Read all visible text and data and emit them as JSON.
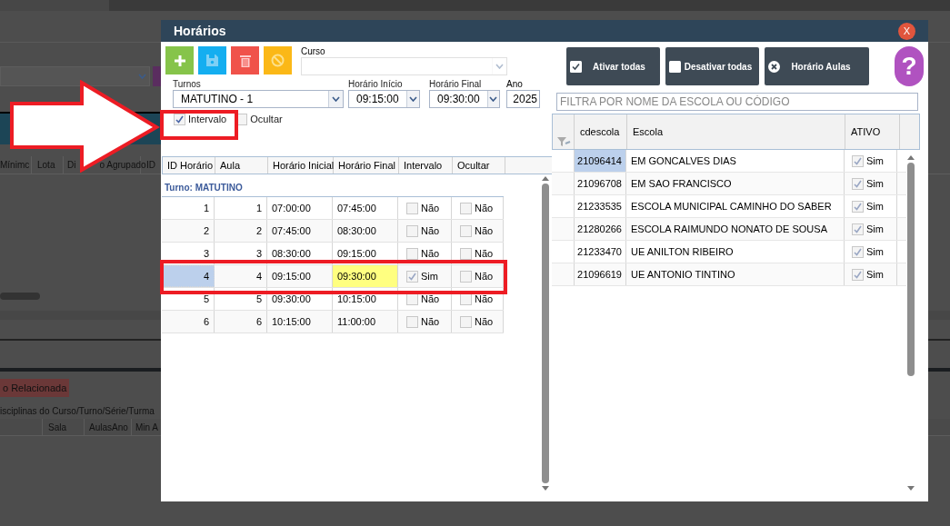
{
  "background": {
    "columns": [
      "Mínimc",
      "Lota",
      "Di",
      "o Agrupado",
      "ID"
    ],
    "related_button": "o Relacionada",
    "section_title": "isciplinas do Curso/Turno/Série/Turma",
    "sub_columns": [
      "Sala",
      "AulasAno",
      "Min A"
    ]
  },
  "dialog": {
    "title": "Horários",
    "close": "X",
    "course": {
      "label": "Curso"
    },
    "shift": {
      "label": "Turnos",
      "value": "MATUTINO - 1"
    },
    "start": {
      "label": "Horário Início",
      "value": "09:15:00"
    },
    "end": {
      "label": "Horário Final",
      "value": "09:30:00"
    },
    "year": {
      "label": "Ano",
      "value": "2025"
    },
    "options": [
      {
        "label": "Intervalo",
        "checked": true
      },
      {
        "label": "Ocultar",
        "checked": false
      }
    ],
    "schedule": {
      "columns": [
        "ID Horário",
        "Aula",
        "Horário Inicial",
        "Horário Final",
        "Intervalo",
        "Ocultar"
      ],
      "group": "Turno: MATUTINO",
      "rows": [
        {
          "id": "1",
          "aula": "1",
          "inicio": "07:00:00",
          "final": "07:45:00",
          "intervalo": {
            "checked": false,
            "label": "Não"
          },
          "ocultar": {
            "checked": false,
            "label": "Não"
          },
          "selected": false,
          "edited": false
        },
        {
          "id": "2",
          "aula": "2",
          "inicio": "07:45:00",
          "final": "08:30:00",
          "intervalo": {
            "checked": false,
            "label": "Não"
          },
          "ocultar": {
            "checked": false,
            "label": "Não"
          },
          "selected": false,
          "edited": false
        },
        {
          "id": "3",
          "aula": "3",
          "inicio": "08:30:00",
          "final": "09:15:00",
          "intervalo": {
            "checked": false,
            "label": "Não"
          },
          "ocultar": {
            "checked": false,
            "label": "Não"
          },
          "selected": false,
          "edited": false
        },
        {
          "id": "4",
          "aula": "4",
          "inicio": "09:15:00",
          "final": "09:30:00",
          "intervalo": {
            "checked": true,
            "label": "Sim"
          },
          "ocultar": {
            "checked": false,
            "label": "Não"
          },
          "selected": true,
          "edited": true
        },
        {
          "id": "5",
          "aula": "5",
          "inicio": "09:30:00",
          "final": "10:15:00",
          "intervalo": {
            "checked": false,
            "label": "Não"
          },
          "ocultar": {
            "checked": false,
            "label": "Não"
          },
          "selected": false,
          "edited": false
        },
        {
          "id": "6",
          "aula": "6",
          "inicio": "10:15:00",
          "final": "11:00:00",
          "intervalo": {
            "checked": false,
            "label": "Não"
          },
          "ocultar": {
            "checked": false,
            "label": "Não"
          },
          "selected": false,
          "edited": false
        }
      ]
    },
    "actions": [
      {
        "kind": "check",
        "label": "Ativar todas"
      },
      {
        "kind": "uncheck",
        "label": "Desativar todas"
      },
      {
        "kind": "close",
        "label": "Horário Aulas"
      }
    ],
    "help": "?",
    "filter": {
      "placeholder": "FILTRA POR NOME DA ESCOLA OU CÓDIGO"
    },
    "schools": {
      "columns": [
        "cdescola",
        "Escola",
        "ATIVO"
      ],
      "rows": [
        {
          "code": "21096414",
          "name": "EM GONCALVES DIAS",
          "active": true,
          "label": "Sim",
          "selected": true
        },
        {
          "code": "21096708",
          "name": "EM SAO FRANCISCO",
          "active": true,
          "label": "Sim",
          "selected": false
        },
        {
          "code": "21233535",
          "name": "ESCOLA MUNICIPAL CAMINHO DO SABER",
          "active": true,
          "label": "Sim",
          "selected": false
        },
        {
          "code": "21280266",
          "name": "ESCOLA RAIMUNDO NONATO DE SOUSA",
          "active": true,
          "label": "Sim",
          "selected": false
        },
        {
          "code": "21233470",
          "name": "UE ANILTON RIBEIRO",
          "active": true,
          "label": "Sim",
          "selected": false
        },
        {
          "code": "21096619",
          "name": "UE ANTONIO TINTINO",
          "active": true,
          "label": "Sim",
          "selected": false
        }
      ]
    }
  }
}
